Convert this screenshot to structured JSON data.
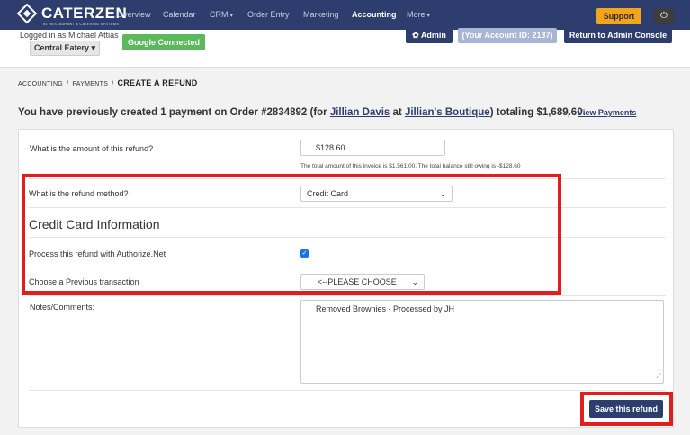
{
  "brand": {
    "name": "CATERZEN",
    "tagline": "#1 RESTAURANT & CATERING SYSTEMS"
  },
  "nav": {
    "items": [
      {
        "label": "Overview"
      },
      {
        "label": "Calendar"
      },
      {
        "label": "CRM",
        "caret": "▾"
      },
      {
        "label": "Order Entry"
      },
      {
        "label": "Marketing"
      },
      {
        "label": "Accounting",
        "active": true
      },
      {
        "label": "More",
        "caret": "▾"
      }
    ],
    "support_label": "Support",
    "power_icon": "power-icon"
  },
  "subheader": {
    "logged_in": "Logged in as Michael Attias",
    "venue": "Central Eatery ▾",
    "google": "Google Connected",
    "admin": "✿ Admin",
    "account": "(Your Account ID: 2137)",
    "return": "Return to Admin Console"
  },
  "breadcrumb": {
    "level1": "ACCOUNTING",
    "sep": "/",
    "level2": "PAYMENTS",
    "current": "CREATE A REFUND"
  },
  "headline": {
    "prefix": "You have previously created 1 payment on Order #2834892 (for ",
    "client": "Jillian Davis",
    "at": " at ",
    "company": "Jillian's Boutique",
    "suffix": ") totaling $1,689.60.",
    "view_payments": "View Payments"
  },
  "form": {
    "amount_label": "What is the amount of this refund?",
    "amount_value": "$128.60",
    "amount_help": "The total amount of this invoice is $1,561.00. The total balance still owing is -$128.60",
    "method_label": "What is the refund method?",
    "method_value": "Credit Card",
    "cc_section_title": "Credit Card Information",
    "authorize_label": "Process this refund with Authorize.Net",
    "authorize_checked": true,
    "prev_txn_label": "Choose a Previous transaction",
    "prev_txn_value": "<--PLEASE CHOOSE",
    "notes_label": "Notes/Comments:",
    "notes_value": "Removed Brownies - Processed by JH",
    "save_label": "Save this refund"
  },
  "colors": {
    "navy": "#2d3e6e",
    "highlight": "#e01e1e",
    "support": "#f2a51a",
    "google": "#5cb85c"
  }
}
